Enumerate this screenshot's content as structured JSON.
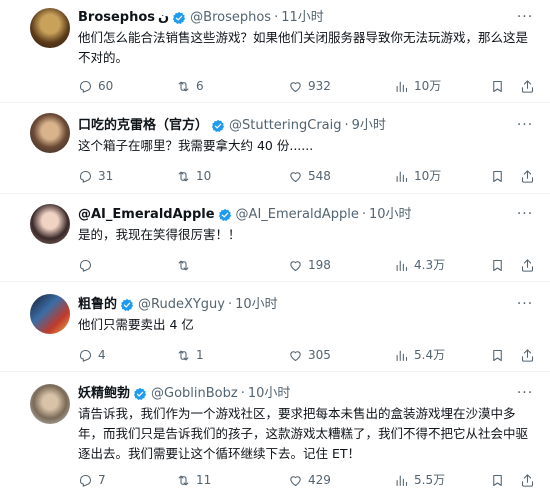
{
  "tweets": [
    {
      "name": "Brosephos",
      "name_suffix": "ن",
      "handle": "@Brosephos",
      "time": "11小时",
      "text": "他们怎么能合法销售这些游戏？如果他们关闭服务器导致你无法玩游戏，那么这是不对的。",
      "stats": {
        "replies": "60",
        "retweets": "6",
        "likes": "932",
        "views": "10万"
      }
    },
    {
      "name": "口吃的克雷格（官方）",
      "handle": "@StutteringCraig",
      "time": "9小时",
      "text": "这个箱子在哪里？我需要拿大约 40 份......",
      "stats": {
        "replies": "31",
        "retweets": "10",
        "likes": "548",
        "views": "10万"
      }
    },
    {
      "name": "@AI_EmeraldApple",
      "handle": "@AI_EmeraldApple",
      "time": "10小时",
      "text": "是的，我现在笑得很厉害！！",
      "stats": {
        "replies": "",
        "retweets": "",
        "likes": "198",
        "views": "4.3万"
      }
    },
    {
      "name": "粗鲁的",
      "handle": "@RudeXYguy",
      "time": "10小时",
      "text": "他们只需要卖出 4 亿",
      "stats": {
        "replies": "4",
        "retweets": "1",
        "likes": "305",
        "views": "5.4万"
      }
    },
    {
      "name": "妖精鲍勃",
      "handle": "@GoblinBobz",
      "time": "10小时",
      "text": "请告诉我，我们作为一个游戏社区，要求把每本未售出的盒装游戏埋在沙漠中多年，而我们只是告诉我们的孩子，这款游戏太糟糕了，我们不得不把它从社会中驱逐出去。我们需要让这个循环继续下去。记住 ET！",
      "stats": {
        "replies": "7",
        "retweets": "11",
        "likes": "429",
        "views": "5.5万"
      }
    }
  ],
  "colors": {
    "verified": "#1d9bf0",
    "muted": "#536471",
    "text": "#0f1419"
  }
}
